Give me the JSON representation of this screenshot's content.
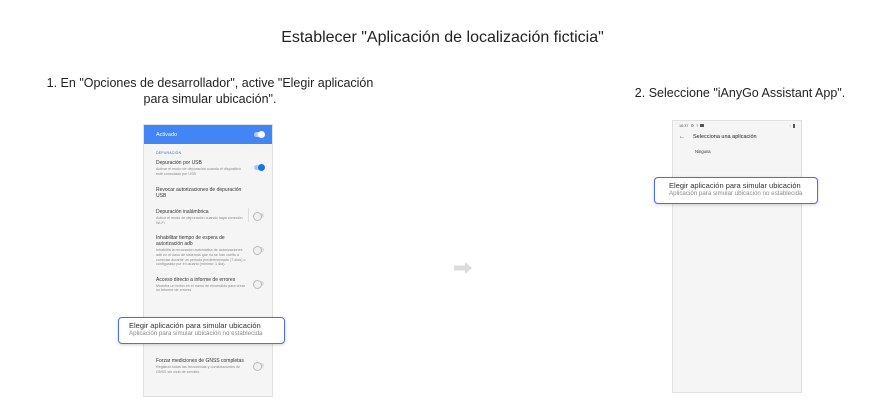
{
  "title": "Establecer \"Aplicación de localización ficticia\"",
  "step1": {
    "caption_line1": "1. En \"Opciones de desarrollador\", active \"Elegir aplicación",
    "caption_line2": "para simular ubicación\".",
    "screen": {
      "top_toggle_label": "Activado",
      "section_label": "DEPURACIÓN",
      "items": [
        {
          "title": "Depuración por USB",
          "subtitle": "Activar el modo de depuración cuando el dispositivo esté conectado por USB",
          "toggle": "on"
        },
        {
          "title": "Revocar autorizaciones de depuración USB",
          "subtitle": "",
          "toggle": "none"
        },
        {
          "title": "Depuración inalámbrica",
          "subtitle": "Activa el modo de depuración cuando haya conexión Wi-Fi",
          "toggle": "off"
        },
        {
          "title": "Inhabilitar tiempo de espera de autorización adb",
          "subtitle": "Inhabilita la revocación automática de autorizaciones adb en el caso de sistemas que no se han vuelto a conectar durante un periodo predeterminado (7 días) o configurado por el usuario (mínimo: 1 día).",
          "toggle": "off"
        },
        {
          "title": "Acceso directo a informe de errores",
          "subtitle": "Muestra un botón en el menú de encendido para crear un informe de errores",
          "toggle": "off"
        }
      ],
      "bottom_item": {
        "title": "Forzar mediciones de GNSS completas",
        "subtitle": "Registrar todas las frecuencias y constelaciones de GNSS sin ciclo de servicio",
        "toggle": "off"
      }
    },
    "highlight": {
      "title": "Elegir aplicación para simular ubicación",
      "subtitle": "Aplicación para simular ubicación no establecida"
    }
  },
  "step2": {
    "caption": "2. Seleccione \"iAnyGo Assistant App\".",
    "screen": {
      "status_time": "16:37",
      "header_title": "Selecciona una aplicación",
      "option_none": "Ninguna"
    },
    "highlight": {
      "title": "Elegir aplicación para simular ubicación",
      "subtitle": "Aplicación para simular ubicación no establecida"
    }
  },
  "colors": {
    "accent_blue": "#4285f4",
    "highlight_border": "#4a6cf7",
    "arrow_gray": "#dcdcdc"
  },
  "icons": {
    "arrow": "right-arrow-icon",
    "back": "back-arrow-icon"
  }
}
